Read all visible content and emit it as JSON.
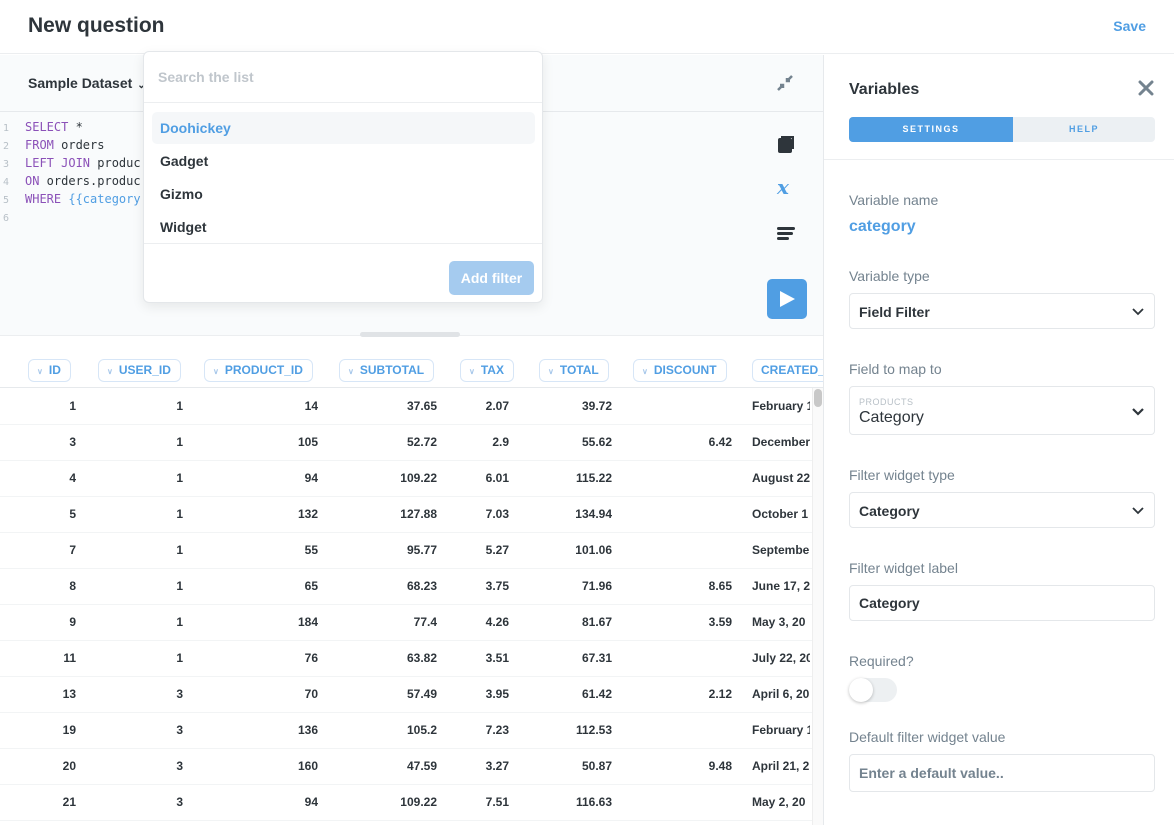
{
  "header": {
    "title": "New question",
    "save_label": "Save"
  },
  "editor": {
    "database": "Sample Dataset",
    "code_lines": [
      {
        "num": "1",
        "parts": [
          {
            "t": "SELECT",
            "c": "kw"
          },
          {
            "t": " *",
            "c": ""
          }
        ]
      },
      {
        "num": "2",
        "parts": [
          {
            "t": "FROM",
            "c": "kw"
          },
          {
            "t": " orders",
            "c": ""
          }
        ]
      },
      {
        "num": "3",
        "parts": [
          {
            "t": "LEFT JOIN",
            "c": "kw"
          },
          {
            "t": " produc",
            "c": ""
          }
        ]
      },
      {
        "num": "4",
        "parts": [
          {
            "t": "ON",
            "c": "kw"
          },
          {
            "t": " orders.produc",
            "c": ""
          }
        ]
      },
      {
        "num": "5",
        "parts": [
          {
            "t": "WHERE",
            "c": "kw"
          },
          {
            "t": " {{category",
            "c": "tv"
          }
        ]
      },
      {
        "num": "6",
        "parts": []
      }
    ],
    "tools": [
      "collapse-icon",
      "snippets-icon",
      "variables-icon",
      "format-icon",
      "run-icon"
    ]
  },
  "popover": {
    "search_placeholder": "Search the list",
    "options": [
      "Doohickey",
      "Gadget",
      "Gizmo",
      "Widget"
    ],
    "active_option": "Doohickey",
    "add_filter_label": "Add filter"
  },
  "table": {
    "columns": [
      "ID",
      "USER_ID",
      "PRODUCT_ID",
      "SUBTOTAL",
      "TAX",
      "TOTAL",
      "DISCOUNT",
      "CREATED_"
    ],
    "rows": [
      [
        "1",
        "1",
        "14",
        "37.65",
        "2.07",
        "39.72",
        "",
        "February 1"
      ],
      [
        "3",
        "1",
        "105",
        "52.72",
        "2.9",
        "55.62",
        "6.42",
        "December"
      ],
      [
        "4",
        "1",
        "94",
        "109.22",
        "6.01",
        "115.22",
        "",
        "August 22"
      ],
      [
        "5",
        "1",
        "132",
        "127.88",
        "7.03",
        "134.94",
        "",
        "October 1"
      ],
      [
        "7",
        "1",
        "55",
        "95.77",
        "5.27",
        "101.06",
        "",
        "Septembe"
      ],
      [
        "8",
        "1",
        "65",
        "68.23",
        "3.75",
        "71.96",
        "8.65",
        "June 17, 2"
      ],
      [
        "9",
        "1",
        "184",
        "77.4",
        "4.26",
        "81.67",
        "3.59",
        "May 3, 20"
      ],
      [
        "11",
        "1",
        "76",
        "63.82",
        "3.51",
        "67.31",
        "",
        "July 22, 20"
      ],
      [
        "13",
        "3",
        "70",
        "57.49",
        "3.95",
        "61.42",
        "2.12",
        "April 6, 20"
      ],
      [
        "19",
        "3",
        "136",
        "105.2",
        "7.23",
        "112.53",
        "",
        "February 1"
      ],
      [
        "20",
        "3",
        "160",
        "47.59",
        "3.27",
        "50.87",
        "9.48",
        "April 21, 2"
      ],
      [
        "21",
        "3",
        "94",
        "109.22",
        "7.51",
        "116.63",
        "",
        "May 2, 20"
      ]
    ]
  },
  "panel": {
    "title": "Variables",
    "tabs": [
      "SETTINGS",
      "HELP"
    ],
    "active_tab": "SETTINGS",
    "variable_name_label": "Variable name",
    "variable_name": "category",
    "variable_type_label": "Variable type",
    "variable_type": "Field Filter",
    "field_map_label": "Field to map to",
    "field_map_table": "PRODUCTS",
    "field_map_field": "Category",
    "widget_type_label": "Filter widget type",
    "widget_type": "Category",
    "widget_label_label": "Filter widget label",
    "widget_label_value": "Category",
    "required_label": "Required?",
    "required": false,
    "default_label": "Default filter widget value",
    "default_placeholder": "Enter a default value.."
  },
  "colors": {
    "accent": "#509ee3",
    "text": "#2e353b",
    "muted": "#74838f",
    "keyword": "#8b51b8"
  }
}
